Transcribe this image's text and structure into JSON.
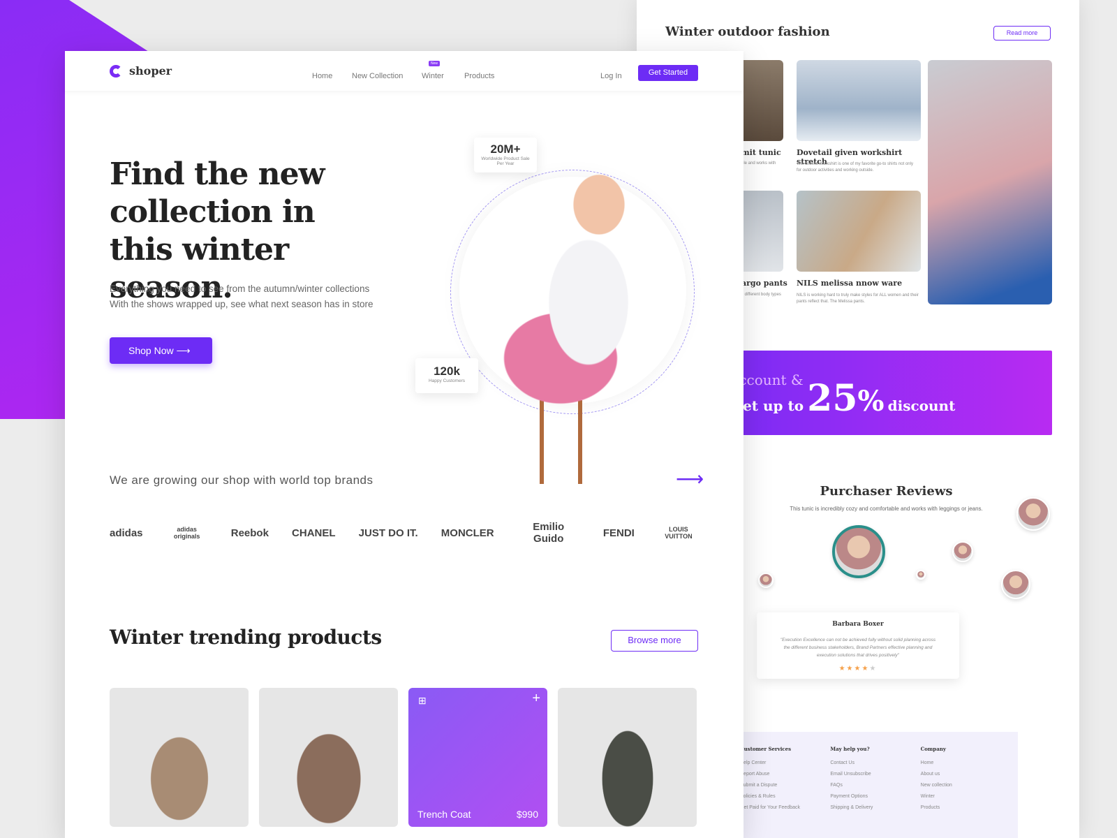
{
  "colors": {
    "accent": "#6d2cf5",
    "banner": "#a62bf2",
    "star": "#f5a04a"
  },
  "back": {
    "title": "Winter outdoor fashion",
    "read_more": "Read more",
    "posts": [
      {
        "title": "mit tunic",
        "desc": "ble and works with"
      },
      {
        "title": "Dovetail given workshirt stretch",
        "desc": "The Givens Workshirt is one of my favorite go-to shirts not only for outdoor activities and working outside."
      },
      {
        "title": "argo pants",
        "desc": "y different body types"
      },
      {
        "title": "NILS melissa nnow ware",
        "desc": "NILS is working hard to truly make styles for ALL women and their pants reflect that. The Melissa pants."
      }
    ],
    "banner": {
      "line1": "t account &",
      "pre": "Get up to",
      "big": "25",
      "pct": "%",
      "post": "discount"
    },
    "reviews": {
      "title": "Purchaser Reviews",
      "subtitle": "This tunic is incredibly cozy and comfortable and works with leggings or jeans.",
      "name": "Barbara Boxer",
      "quote": "\"Execution Excellence can not be achieved fully without solid planning across the different business stakeholders, Brand Partners  effective planning and execution solutions that drives positively\"",
      "rating": 4,
      "max_rating": 5
    },
    "footer": [
      {
        "heading": "Customer Services",
        "items": [
          "Help Center",
          "Report Abuse",
          "Submit a Dispute",
          "Policies & Rules",
          "Get Paid for Your Feedback"
        ]
      },
      {
        "heading": "May help you?",
        "items": [
          "Contact Us",
          "Email Unsubscribe",
          "FAQs",
          "Payment Options",
          "Shipping & Delivery"
        ]
      },
      {
        "heading": "Company",
        "items": [
          "Home",
          "About us",
          "New collection",
          "Winter",
          "Products"
        ]
      }
    ]
  },
  "nav": {
    "logo": "shoper",
    "items": [
      "Home",
      "New Collection",
      "Winter",
      "Products"
    ],
    "new_badge": "New",
    "login": "Log In",
    "cta": "Get Started"
  },
  "hero": {
    "title": "Find the new collection in this winter season.",
    "desc1": "Everything you need to see from the autumn/winter collections",
    "desc2": "With the shows wrapped up, see what next season has in store",
    "cta": "Shop Now",
    "stat1": {
      "value": "20M+",
      "label": "Worldwide Product Sale Per Year"
    },
    "stat2": {
      "value": "120k",
      "label": "Happy Customers"
    }
  },
  "brands": {
    "title": "We are growing our shop with world top brands",
    "list": [
      "adidas",
      "adidas originals",
      "Reebok",
      "CHANEL",
      "JUST DO IT.",
      "MONCLER",
      "Emilio Guido",
      "FENDI",
      "LOUIS VUITTON"
    ]
  },
  "trending": {
    "title": "Winter trending products",
    "browse": "Browse more",
    "featured": {
      "name": "Trench Coat",
      "price": "$990"
    }
  }
}
